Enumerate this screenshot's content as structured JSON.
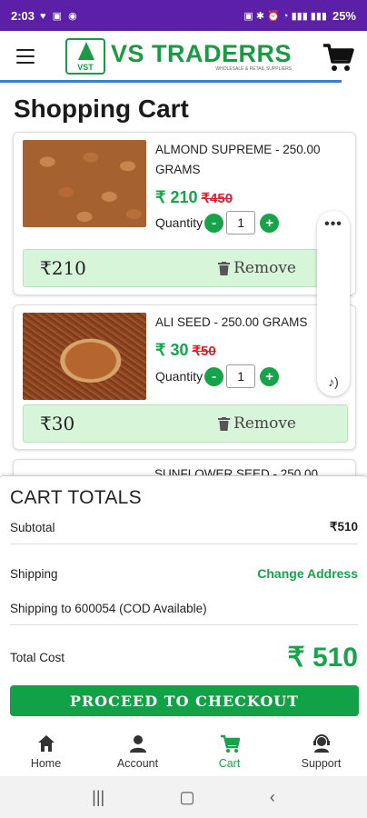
{
  "status_bar": {
    "time": "2:03",
    "battery": "25%"
  },
  "header": {
    "brand": "VS TRADERRS",
    "logo_mark": "VST",
    "tagline": "WHOLESALE & RETAIL SUPPLIERS"
  },
  "page": {
    "title": "Shopping Cart"
  },
  "items": [
    {
      "name": "ALMOND SUPREME - 250.00 GRAMS",
      "price": "₹ 210",
      "old_price": "₹450",
      "qty_label": "Quantity",
      "qty": "1",
      "line_total": "₹210",
      "remove_label": "Remove",
      "image": "almonds"
    },
    {
      "name": "ALI SEED - 250.00 GRAMS",
      "price": "₹ 30",
      "old_price": "₹50",
      "qty_label": "Quantity",
      "qty": "1",
      "line_total": "₹30",
      "remove_label": "Remove",
      "image": "flax-seeds"
    },
    {
      "name": "SUNFLOWER SEED - 250.00"
    }
  ],
  "totals": {
    "title": "CART TOTALS",
    "subtotal_label": "Subtotal",
    "subtotal_value": "₹510",
    "shipping_label": "Shipping",
    "change_address": "Change Address",
    "shipping_note": "Shipping to 600054 (COD Available)",
    "total_label": "Total Cost",
    "total_value": "₹ 510",
    "checkout_label": "PROCEED TO CHECKOUT"
  },
  "nav": [
    {
      "label": "Home",
      "icon": "home-icon"
    },
    {
      "label": "Account",
      "icon": "account-icon"
    },
    {
      "label": "Cart",
      "icon": "cart-icon"
    },
    {
      "label": "Support",
      "icon": "support-icon"
    }
  ],
  "colors": {
    "accent": "#16a34a",
    "status_bar": "#5b1fa8",
    "remove_bar": "#d6f5d9",
    "strike_price": "#e11d2a"
  }
}
